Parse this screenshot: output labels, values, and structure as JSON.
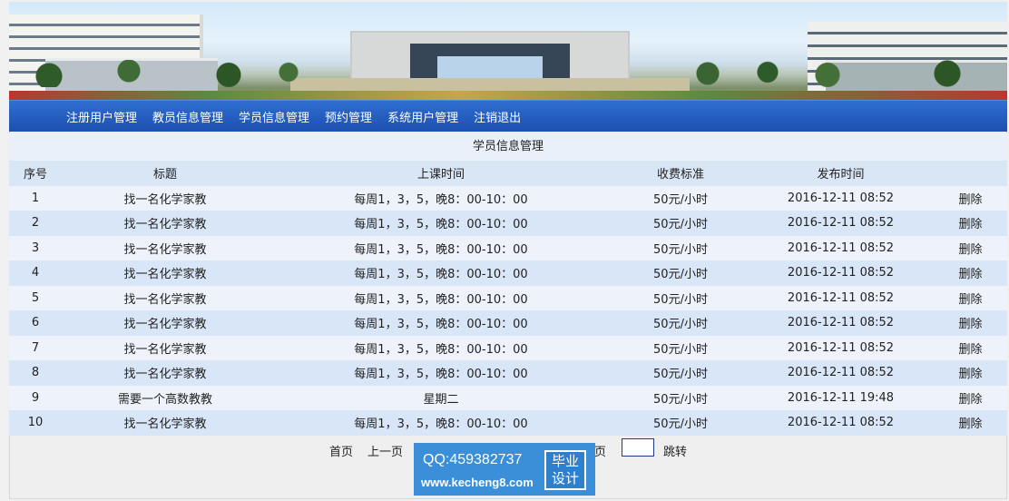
{
  "nav": {
    "items": [
      "注册用户管理",
      "教员信息管理",
      "学员信息管理",
      "预约管理",
      "系统用户管理",
      "注销退出"
    ]
  },
  "page": {
    "title": "学员信息管理"
  },
  "table": {
    "headers": [
      "序号",
      "标题",
      "上课时间",
      "收费标准",
      "发布时间",
      ""
    ],
    "rows": [
      {
        "id": "1",
        "title": "找一名化学家教",
        "time": "每周1，3，5，晚8：00-10：00",
        "fee": "50元/小时",
        "date": "2016-12-11 08:52",
        "op": "删除"
      },
      {
        "id": "2",
        "title": "找一名化学家教",
        "time": "每周1，3，5，晚8：00-10：00",
        "fee": "50元/小时",
        "date": "2016-12-11 08:52",
        "op": "删除"
      },
      {
        "id": "3",
        "title": "找一名化学家教",
        "time": "每周1，3，5，晚8：00-10：00",
        "fee": "50元/小时",
        "date": "2016-12-11 08:52",
        "op": "删除"
      },
      {
        "id": "4",
        "title": "找一名化学家教",
        "time": "每周1，3，5，晚8：00-10：00",
        "fee": "50元/小时",
        "date": "2016-12-11 08:52",
        "op": "删除"
      },
      {
        "id": "5",
        "title": "找一名化学家教",
        "time": "每周1，3，5，晚8：00-10：00",
        "fee": "50元/小时",
        "date": "2016-12-11 08:52",
        "op": "删除"
      },
      {
        "id": "6",
        "title": "找一名化学家教",
        "time": "每周1，3，5，晚8：00-10：00",
        "fee": "50元/小时",
        "date": "2016-12-11 08:52",
        "op": "删除"
      },
      {
        "id": "7",
        "title": "找一名化学家教",
        "time": "每周1，3，5，晚8：00-10：00",
        "fee": "50元/小时",
        "date": "2016-12-11 08:52",
        "op": "删除"
      },
      {
        "id": "8",
        "title": "找一名化学家教",
        "time": "每周1，3，5，晚8：00-10：00",
        "fee": "50元/小时",
        "date": "2016-12-11 08:52",
        "op": "删除"
      },
      {
        "id": "9",
        "title": "需要一个高数教教",
        "time": "星期二",
        "fee": "50元/小时",
        "date": "2016-12-11 19:48",
        "op": "删除"
      },
      {
        "id": "10",
        "title": "找一名化学家教",
        "time": "每周1，3，5，晚8：00-10：00",
        "fee": "50元/小时",
        "date": "2016-12-11 08:52",
        "op": "删除"
      }
    ]
  },
  "pager": {
    "first": "首页",
    "prev": "上一页",
    "page_suffix": "页",
    "jump_value": "",
    "jump": "跳转"
  },
  "watermark": {
    "qq": "QQ:459382737",
    "url": "www.kecheng8.com",
    "badge_line1": "毕业",
    "badge_line2": "设计"
  },
  "colors": {
    "nav_bg": "#1d4fb0",
    "header_row": "#d9e6f6",
    "row_odd": "#eef3fb",
    "row_even": "#d8e6f8",
    "watermark_bg": "#3a8fd8"
  }
}
